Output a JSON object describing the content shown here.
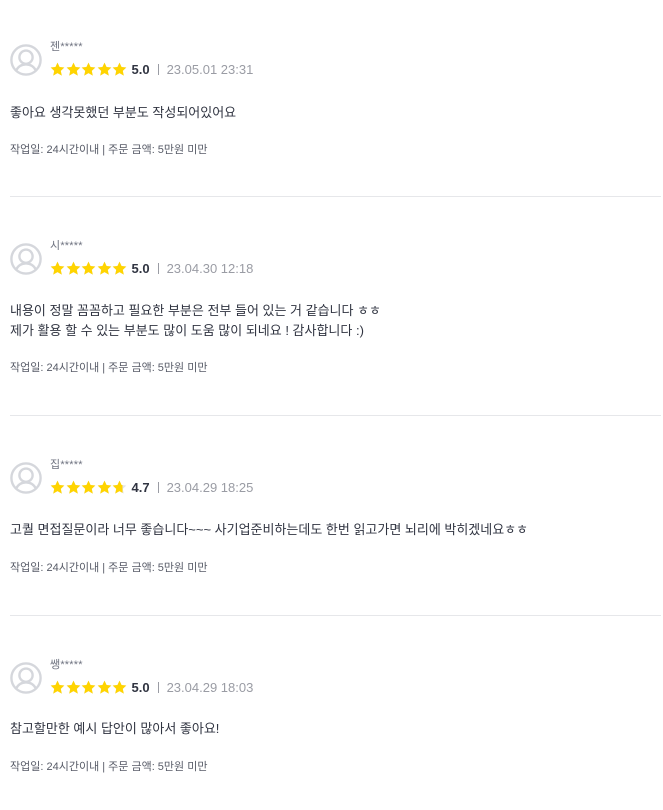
{
  "colors": {
    "star": "#ffd400",
    "text": "#303441",
    "muted": "#9a9ca4",
    "divider": "#e6e7ea",
    "avatar": "#d5d7dc"
  },
  "icons": {
    "avatar": "user-avatar-icon",
    "star": "star-icon"
  },
  "reviews": [
    {
      "name": "젠*****",
      "score": "5.0",
      "rating": 5.0,
      "date": "23.05.01 23:31",
      "content": [
        "좋아요 생각못했던 부분도 작성되어있어요"
      ],
      "meta": "작업일: 24시간이내 | 주문 금액: 5만원 미만"
    },
    {
      "name": "시*****",
      "score": "5.0",
      "rating": 5.0,
      "date": "23.04.30 12:18",
      "content": [
        "내용이 정말 꼼꼼하고 필요한 부분은 전부 들어 있는 거 같습니다 ㅎㅎ",
        "제가 활용 할 수 있는 부분도 많이 도움 많이 되네요 ! 감사합니다 :)"
      ],
      "meta": "작업일: 24시간이내 | 주문 금액: 5만원 미만"
    },
    {
      "name": "집*****",
      "score": "4.7",
      "rating": 4.7,
      "date": "23.04.29 18:25",
      "content": [
        "고퀄 면접질문이라 너무 좋습니다~~~ 사기업준비하는데도 한번 읽고가면 뇌리에 박히겠네요ㅎㅎ"
      ],
      "meta": "작업일: 24시간이내 | 주문 금액: 5만원 미만"
    },
    {
      "name": "쌩*****",
      "score": "5.0",
      "rating": 5.0,
      "date": "23.04.29 18:03",
      "content": [
        "참고할만한 예시 답안이 많아서 좋아요!"
      ],
      "meta": "작업일: 24시간이내 | 주문 금액: 5만원 미만"
    }
  ]
}
